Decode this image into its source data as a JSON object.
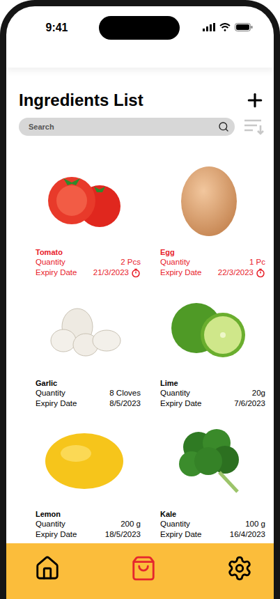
{
  "status_bar": {
    "time": "9:41"
  },
  "header": {
    "title": "Ingredients List"
  },
  "search": {
    "placeholder": "Search"
  },
  "ingredients": [
    {
      "name": "Tomato",
      "quantity_label": "Quantity",
      "quantity": "2 Pcs",
      "expiry_label": "Expiry Date",
      "expiry": "21/3/2023",
      "expiring": true,
      "kind": "tomato"
    },
    {
      "name": "Egg",
      "quantity_label": "Quantity",
      "quantity": "1 Pc",
      "expiry_label": "Expiry Date",
      "expiry": "22/3/2023",
      "expiring": true,
      "kind": "egg"
    },
    {
      "name": "Garlic",
      "quantity_label": "Quantity",
      "quantity": "8 Cloves",
      "expiry_label": "Expiry Date",
      "expiry": "8/5/2023",
      "expiring": false,
      "kind": "garlic"
    },
    {
      "name": "Lime",
      "quantity_label": "Quantity",
      "quantity": "20g",
      "expiry_label": "Expiry Date",
      "expiry": "7/6/2023",
      "expiring": false,
      "kind": "lime"
    },
    {
      "name": "Lemon",
      "quantity_label": "Quantity",
      "quantity": "200 g",
      "expiry_label": "Expiry Date",
      "expiry": "18/5/2023",
      "expiring": false,
      "kind": "lemon"
    },
    {
      "name": "Kale",
      "quantity_label": "Quantity",
      "quantity": "100 g",
      "expiry_label": "Expiry Date",
      "expiry": "16/4/2023",
      "expiring": false,
      "kind": "kale"
    }
  ],
  "nav": [
    {
      "kind": "home",
      "selected": false
    },
    {
      "kind": "bag",
      "selected": true
    },
    {
      "kind": "settings",
      "selected": false
    }
  ]
}
